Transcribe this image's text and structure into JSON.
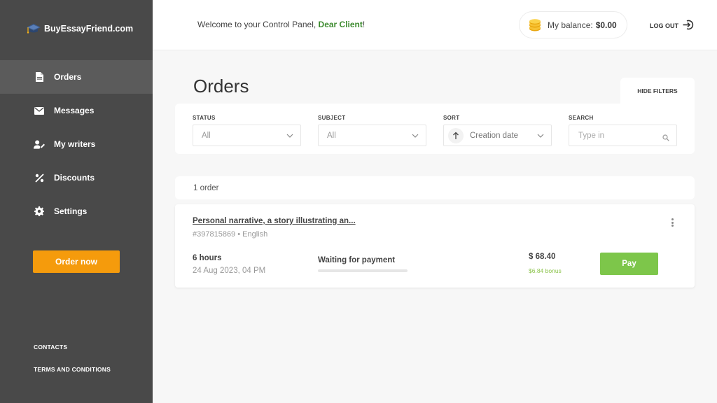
{
  "sidebar": {
    "logo_text": "BuyEssayFriend.com",
    "items": [
      {
        "label": "Orders",
        "icon": "document-icon",
        "active": true
      },
      {
        "label": "Messages",
        "icon": "envelope-icon",
        "active": false
      },
      {
        "label": "My writers",
        "icon": "user-edit-icon",
        "active": false
      },
      {
        "label": "Discounts",
        "icon": "percent-icon",
        "active": false
      },
      {
        "label": "Settings",
        "icon": "gear-icon",
        "active": false
      }
    ],
    "order_button": "Order now",
    "contacts": "CONTACTS",
    "terms": "TERMS AND CONDITIONS"
  },
  "header": {
    "welcome_prefix": "Welcome to your Control Panel, ",
    "client_name": "Dear Client",
    "welcome_suffix": "!",
    "balance_label": "My balance:",
    "balance_value": "$0.00",
    "logout": "LOG OUT"
  },
  "main": {
    "title": "Orders",
    "hide_filters": "HIDE FILTERS",
    "filters": {
      "status_label": "STATUS",
      "status_value": "All",
      "subject_label": "SUBJECT",
      "subject_value": "All",
      "sort_label": "SORT",
      "sort_value": "Creation date",
      "search_label": "SEARCH",
      "search_placeholder": "Type in",
      "search_value": ""
    },
    "order_count": "1 order",
    "orders": [
      {
        "title": "Personal narrative, a story illustrating an...",
        "meta": "#397815869 • English",
        "deadline": "6 hours",
        "created": "24 Aug 2023, 04 PM",
        "status": "Waiting for payment",
        "progress": 0,
        "price": "$ 68.40",
        "bonus": "$6.84 bonus",
        "pay_label": "Pay"
      }
    ]
  },
  "colors": {
    "sidebar_bg": "#494949",
    "accent_orange": "#f59b0c",
    "pay_green": "#7dc64a",
    "client_green": "#3d8b2f",
    "bonus_green": "#8bc34a"
  }
}
